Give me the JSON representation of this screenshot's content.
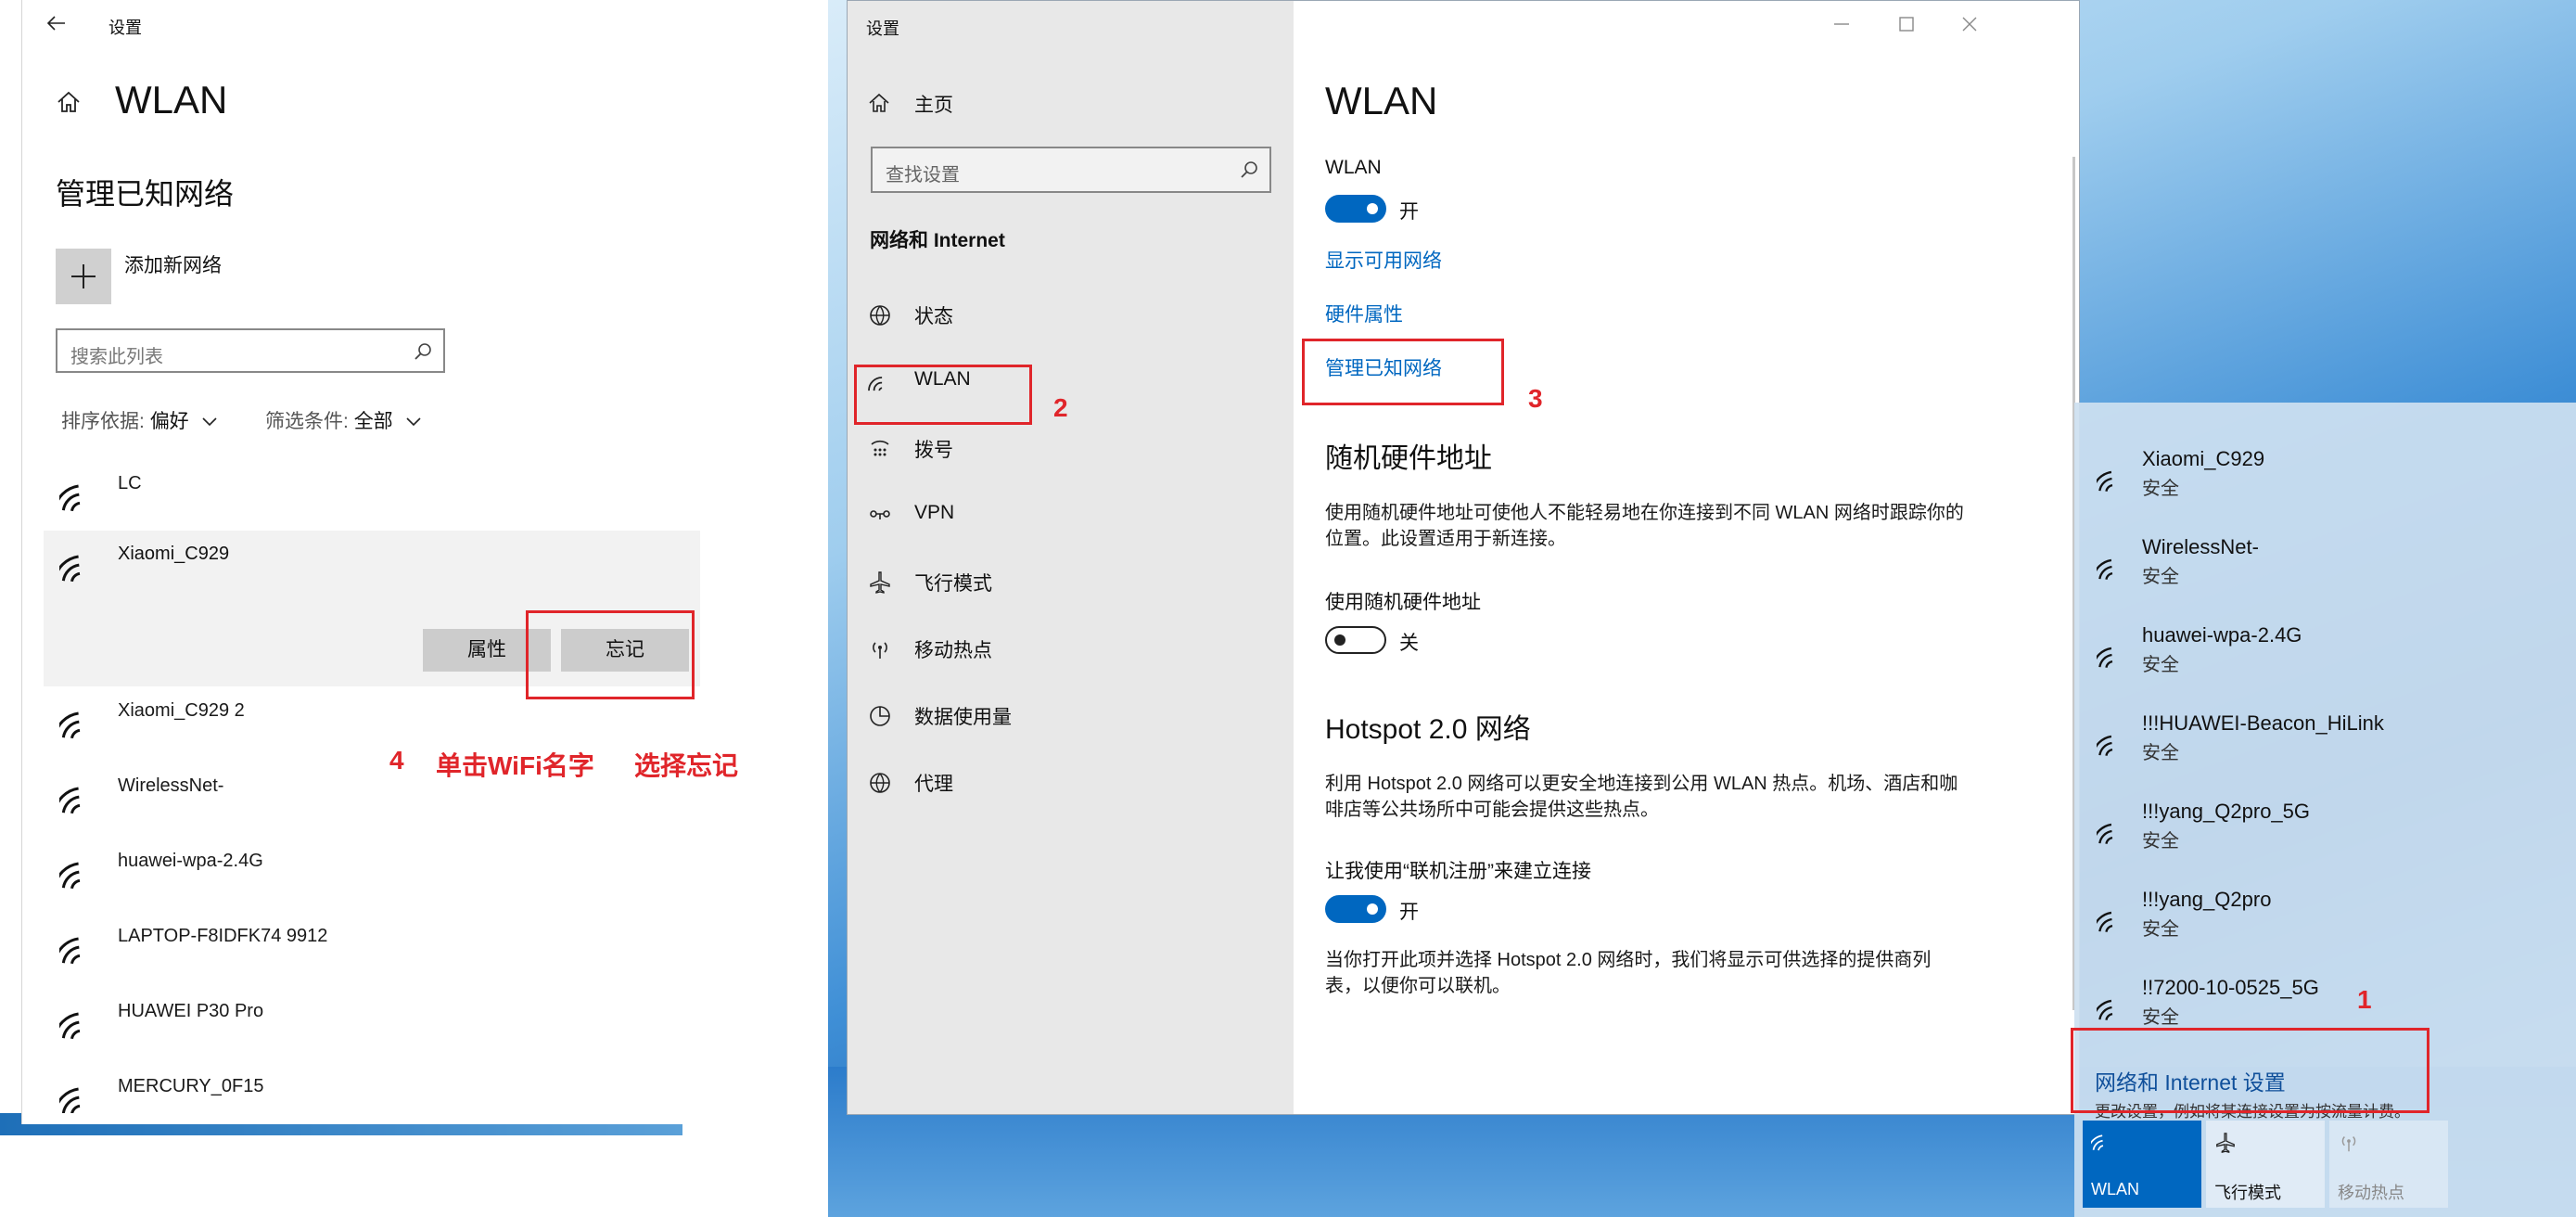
{
  "left_window": {
    "title": "设置",
    "heading": "WLAN",
    "section_title": "管理已知网络",
    "add_network": "添加新网络",
    "search_placeholder": "搜索此列表",
    "sort_label": "排序依据:",
    "sort_value": "偏好",
    "filter_label": "筛选条件:",
    "filter_value": "全部",
    "networks": [
      "LC",
      "Xiaomi_C929",
      "Xiaomi_C929 2",
      "WirelessNet-",
      "huawei-wpa-2.4G",
      "LAPTOP-F8IDFK74 9912",
      "HUAWEI P30 Pro",
      "MERCURY_0F15"
    ],
    "properties_button": "属性",
    "forget_button": "忘记"
  },
  "annotations": {
    "step4_num": "4",
    "step4_a": "单击WiFi名字",
    "step4_b": "选择忘记",
    "step1": "1",
    "step2": "2",
    "step3": "3"
  },
  "settings_window": {
    "title": "设置",
    "home": "主页",
    "search_placeholder": "查找设置",
    "category": "网络和 Internet",
    "nav": [
      "状态",
      "WLAN",
      "拨号",
      "VPN",
      "飞行模式",
      "移动热点",
      "数据使用量",
      "代理"
    ],
    "page_title": "WLAN",
    "wlan_label": "WLAN",
    "wlan_state": "开",
    "link_show": "显示可用网络",
    "link_hw": "硬件属性",
    "link_manage": "管理已知网络",
    "random_title": "随机硬件地址",
    "random_desc": "使用随机硬件地址可使他人不能轻易地在你连接到不同 WLAN 网络时跟踪你的位置。此设置适用于新连接。",
    "random_label": "使用随机硬件地址",
    "random_state": "关",
    "hotspot_title": "Hotspot 2.0 网络",
    "hotspot_desc": "利用 Hotspot 2.0 网络可以更安全地连接到公用 WLAN 热点。机场、酒店和咖啡店等公共场所中可能会提供这些热点。",
    "online_label": "让我使用“联机注册”来建立连接",
    "online_state": "开",
    "online_desc": "当你打开此项并选择 Hotspot 2.0 网络时，我们将显示可供选择的提供商列表，以便你可以联机。"
  },
  "flyout": {
    "networks": [
      {
        "name": "Xiaomi_C929",
        "status": "安全"
      },
      {
        "name": "WirelessNet-",
        "status": "安全"
      },
      {
        "name": "huawei-wpa-2.4G",
        "status": "安全"
      },
      {
        "name": "!!!HUAWEI-Beacon_HiLink",
        "status": "安全"
      },
      {
        "name": "!!!yang_Q2pro_5G",
        "status": "安全"
      },
      {
        "name": "!!!yang_Q2pro",
        "status": "安全"
      },
      {
        "name": "!!7200-10-0525_5G",
        "status": "安全"
      }
    ],
    "settings_link": "网络和 Internet 设置",
    "settings_sub": "更改设置，例如将某连接设置为按流量计费。",
    "tiles": [
      "WLAN",
      "飞行模式",
      "移动热点"
    ]
  },
  "colors": {
    "accent": "#0067c0",
    "annotation_red": "#e0252a"
  }
}
